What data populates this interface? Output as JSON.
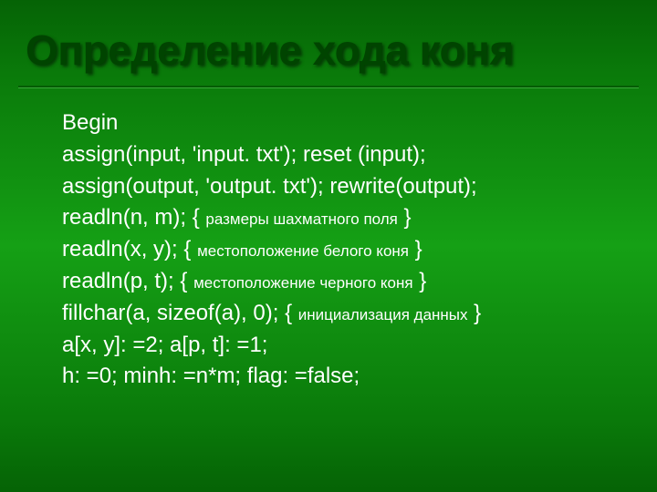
{
  "slide": {
    "title": "Определение хода коня",
    "lines": [
      {
        "code_pre": "Begin",
        "comment": "",
        "code_post": ""
      },
      {
        "code_pre": "assign(input, 'input. txt'); reset (input);",
        "comment": "",
        "code_post": ""
      },
      {
        "code_pre": "assign(output, 'output. txt'); rewrite(output);",
        "comment": "",
        "code_post": ""
      },
      {
        "code_pre": "readln(n, m); { ",
        "comment": "размеры шахматного поля",
        "code_post": " }"
      },
      {
        "code_pre": "readln(x, y); { ",
        "comment": "местоположение белого коня",
        "code_post": " }"
      },
      {
        "code_pre": "readln(p, t); { ",
        "comment": "местоположение черного коня",
        "code_post": " }"
      },
      {
        "code_pre": "fillchar(a, sizeof(a), 0); { ",
        "comment": "инициализация данных",
        "code_post": " }"
      },
      {
        "code_pre": "a[x, y]: =2; a[p, t]: =1;",
        "comment": "",
        "code_post": ""
      },
      {
        "code_pre": "h: =0; minh: =n*m; flag: =false;",
        "comment": "",
        "code_post": ""
      }
    ]
  }
}
